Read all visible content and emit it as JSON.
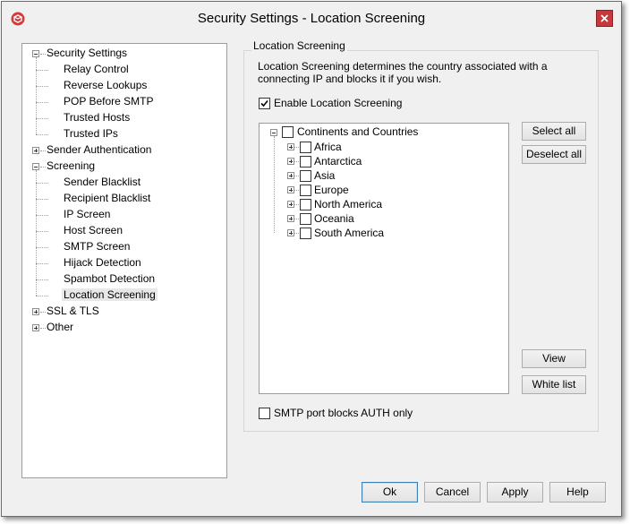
{
  "window": {
    "title": "Security Settings - Location Screening"
  },
  "nav_tree": [
    {
      "label": "Security Settings",
      "expanded": true,
      "children": [
        "Relay Control",
        "Reverse Lookups",
        "POP Before SMTP",
        "Trusted Hosts",
        "Trusted IPs"
      ]
    },
    {
      "label": "Sender Authentication",
      "expanded": false
    },
    {
      "label": "Screening",
      "expanded": true,
      "children": [
        "Sender Blacklist",
        "Recipient Blacklist",
        "IP Screen",
        "Host Screen",
        "SMTP Screen",
        "Hijack Detection",
        "Spambot Detection",
        "Location Screening"
      ]
    },
    {
      "label": "SSL & TLS",
      "expanded": false
    },
    {
      "label": "Other",
      "expanded": false
    }
  ],
  "selected_item": "Location Screening",
  "panel": {
    "group_title": "Location Screening",
    "description": "Location Screening determines the country associated with a connecting IP and blocks it if you wish.",
    "enable_label": "Enable Location Screening",
    "enable_checked": true,
    "auth_only_label": "SMTP port blocks AUTH only",
    "auth_only_checked": false
  },
  "country_tree": {
    "root": "Continents and Countries",
    "continents": [
      "Africa",
      "Antarctica",
      "Asia",
      "Europe",
      "North America",
      "Oceania",
      "South America"
    ]
  },
  "side_buttons": {
    "select_all": "Select all",
    "deselect_all": "Deselect all",
    "view": "View",
    "white_list": "White list"
  },
  "footer_buttons": {
    "ok": "Ok",
    "cancel": "Cancel",
    "apply": "Apply",
    "help": "Help"
  },
  "colors": {
    "close_button": "#c7383d",
    "window_bg": "#f0f0f0",
    "default_button_border": "#3c7fb1"
  }
}
